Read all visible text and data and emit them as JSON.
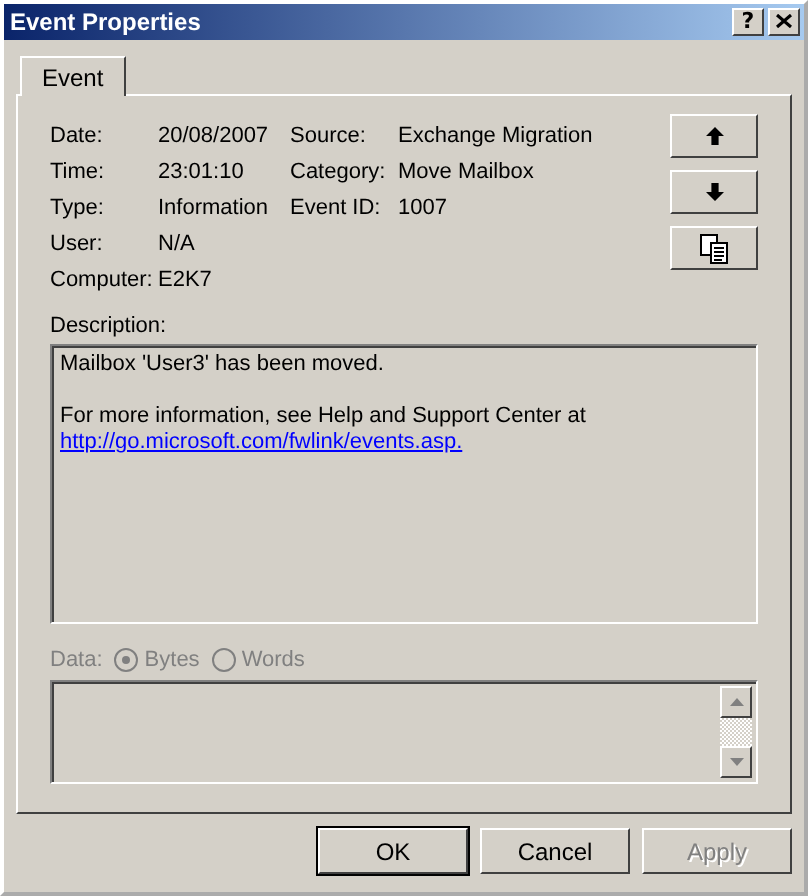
{
  "window": {
    "title": "Event Properties",
    "buttons": [
      {
        "kind": "help",
        "label": "?"
      },
      {
        "kind": "close"
      }
    ]
  },
  "tabs": [
    {
      "label": "Event",
      "selected": true
    }
  ],
  "field_rows": [
    [
      {
        "label": "Date:",
        "value": "20/08/2007"
      },
      {
        "label": "Source:",
        "value": "Exchange Migration"
      }
    ],
    [
      {
        "label": "Time:",
        "value": "23:01:10"
      },
      {
        "label": "Category:",
        "value": "Move Mailbox"
      }
    ],
    [
      {
        "label": "Type:",
        "value": "Information"
      },
      {
        "label": "Event ID:",
        "value": "1007"
      }
    ],
    [
      {
        "label": "User:",
        "value": "N/A"
      }
    ],
    [
      {
        "label": "Computer:",
        "value": "E2K7"
      }
    ]
  ],
  "side_buttons": [
    {
      "kind": "up"
    },
    {
      "kind": "down"
    },
    {
      "kind": "copy"
    }
  ],
  "description": {
    "label": "Description:",
    "paragraphs": [
      "Mailbox 'User3' has been moved.",
      "For more information, see Help and Support Center at"
    ],
    "link": "http://go.microsoft.com/fwlink/events.asp."
  },
  "data": {
    "label": "Data:",
    "disabled": true,
    "options": [
      {
        "label": "Bytes",
        "selected": true
      },
      {
        "label": "Words",
        "selected": false
      }
    ]
  },
  "buttons": [
    {
      "label": "OK",
      "default": true,
      "disabled": false
    },
    {
      "label": "Cancel",
      "default": false,
      "disabled": false
    },
    {
      "label": "Apply",
      "default": false,
      "disabled": true
    }
  ]
}
